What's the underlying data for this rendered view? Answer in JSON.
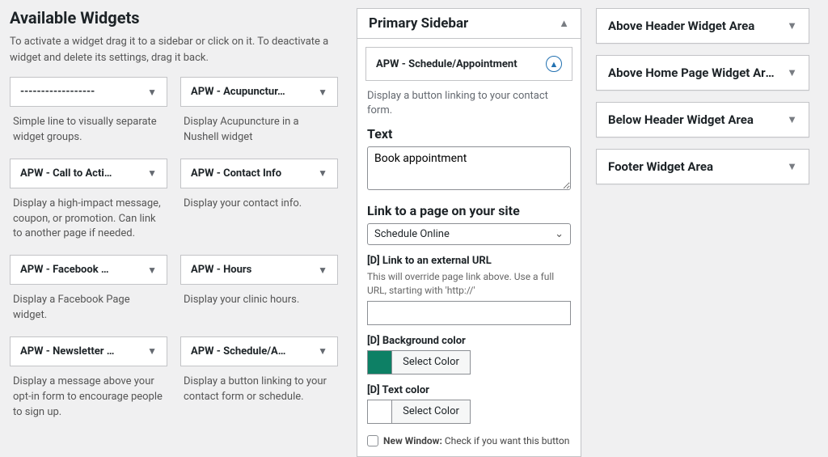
{
  "available": {
    "title": "Available Widgets",
    "intro": "To activate a widget drag it to a sidebar or click on it. To deactivate a widget and delete its settings, drag it back.",
    "widgets": [
      {
        "title": "------------------",
        "desc": "Simple line to visually separate widget groups."
      },
      {
        "title": "APW - Acupunctur…",
        "desc": "Display Acupuncture in a Nushell widget"
      },
      {
        "title": "APW - Call to Acti…",
        "desc": "Display a high-impact message, coupon, or promotion. Can link to another page if needed."
      },
      {
        "title": "APW - Contact Info",
        "desc": "Display your contact info."
      },
      {
        "title": "APW - Facebook …",
        "desc": "Display a Facebook Page widget."
      },
      {
        "title": "APW - Hours",
        "desc": "Display your clinic hours."
      },
      {
        "title": "APW - Newsletter …",
        "desc": "Display a message above your opt-in form to encourage people to sign up."
      },
      {
        "title": "APW - Schedule/A…",
        "desc": "Display a button linking to your contact form or schedule."
      }
    ]
  },
  "primary": {
    "title": "Primary Sidebar",
    "open_widget_title": "APW - Schedule/Appointment",
    "form": {
      "desc": "Display a button linking to your contact form.",
      "text_label": "Text",
      "text_value": "Book appointment",
      "link_page_label": "Link to a page on your site",
      "link_page_value": "Schedule Online",
      "external_label": "[D] Link to an external URL",
      "external_hint": "This will override page link above. Use a full URL, starting with 'http://'",
      "bg_label": "[D] Background color",
      "bg_swatch": "#0d8065",
      "color_button": "Select Color",
      "text_color_label": "[D] Text color",
      "new_window_bold": "New Window:",
      "new_window_rest": " Check if you want this button"
    }
  },
  "areas": [
    "Above Header Widget Area",
    "Above Home Page Widget Area",
    "Below Header Widget Area",
    "Footer Widget Area"
  ]
}
